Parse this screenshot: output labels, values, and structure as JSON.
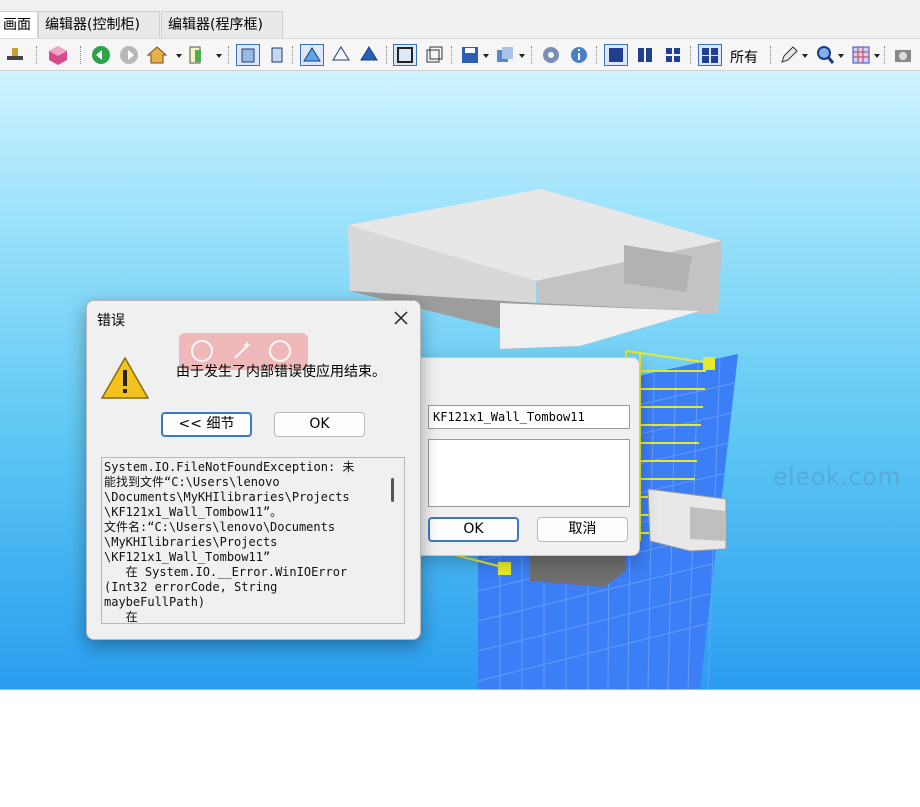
{
  "tabs": [
    {
      "label": "画面",
      "active": true
    },
    {
      "label": "编辑器(控制柜)",
      "active": false
    },
    {
      "label": "编辑器(程序框)",
      "active": false
    }
  ],
  "toolbar": {
    "all_label": "所有",
    "icons": [
      "pin-icon",
      "cube-icon",
      "back-icon",
      "forward-icon",
      "home-icon",
      "frame-icon",
      "front-view-icon",
      "side-view-icon",
      "perspective-icon",
      "wireframe-icon",
      "shaded-icon",
      "window-icon",
      "window-copy-icon",
      "save-icon",
      "copy-icon",
      "settings-icon",
      "info-icon",
      "single-view-icon",
      "dual-view-icon",
      "quad-view-icon",
      "select-all-icon",
      "pencil-icon",
      "zoom-icon",
      "grid-icon",
      "camera-icon"
    ]
  },
  "viewport": {
    "watermark": "eleok.com",
    "colors": {
      "sky_top": "#cff3ff",
      "sky_bottom": "#2a9df0",
      "grid": "#2f6ff0",
      "rail": "#e6ea2a"
    }
  },
  "error_dialog": {
    "title": "错误",
    "message": "由于发生了内部错误使应用结束。",
    "details_button": "<< 细节",
    "ok_button": "OK",
    "details_text": "System.IO.FileNotFoundException: 未\n能找到文件“C:\\Users\\lenovo\n\\Documents\\MyKHIlibraries\\Projects\n\\KF121x1_Wall_Tombow11”。\n文件名:“C:\\Users\\lenovo\\Documents\n\\MyKHIlibraries\\Projects\n\\KF121x1_Wall_Tombow11”\n   在 System.IO.__Error.WinIOError\n(Int32 errorCode, String\nmaybeFullPath)\n   在"
  },
  "input_dialog": {
    "name_value": "KF121x1_Wall_Tombow11",
    "ok_button": "OK",
    "cancel_button": "取消"
  }
}
